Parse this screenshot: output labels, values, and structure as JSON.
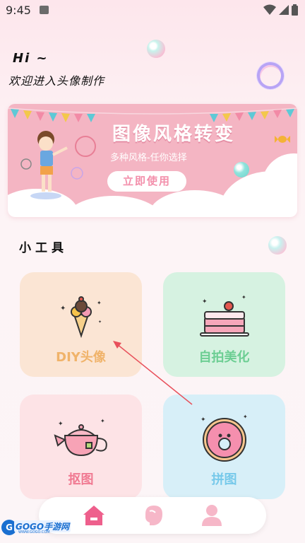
{
  "status_bar": {
    "time": "9:45"
  },
  "greeting": {
    "hi": "Hi ~",
    "subtitle": "欢迎进入头像制作"
  },
  "banner": {
    "title": "图像风格转变",
    "subtitle": "多种风格-任你选择",
    "button_label": "立即使用"
  },
  "tools_section": {
    "title": "小工具"
  },
  "tools": [
    {
      "label": "DIY头像",
      "icon": "ice-cream-icon"
    },
    {
      "label": "自拍美化",
      "icon": "cake-icon"
    },
    {
      "label": "抠图",
      "icon": "teapot-icon"
    },
    {
      "label": "拼图",
      "icon": "donut-icon"
    }
  ],
  "bottom_nav": [
    {
      "icon": "home-icon",
      "active": true
    },
    {
      "icon": "face-profile-icon",
      "active": false
    },
    {
      "icon": "user-icon",
      "active": false
    }
  ],
  "watermark": {
    "logo": "G",
    "text": "GOGO手游网",
    "small": "WWW.GOGO.COM"
  },
  "colors": {
    "accent": "#ee5f8c",
    "banner_bg": "#f4b5c3",
    "tool_diy": "#fbe5d4",
    "tool_selfie": "#d6f2e1",
    "tool_cutout": "#fde3e6",
    "tool_puzzle": "#d7eff8",
    "annotation_arrow": "#e8505b"
  }
}
